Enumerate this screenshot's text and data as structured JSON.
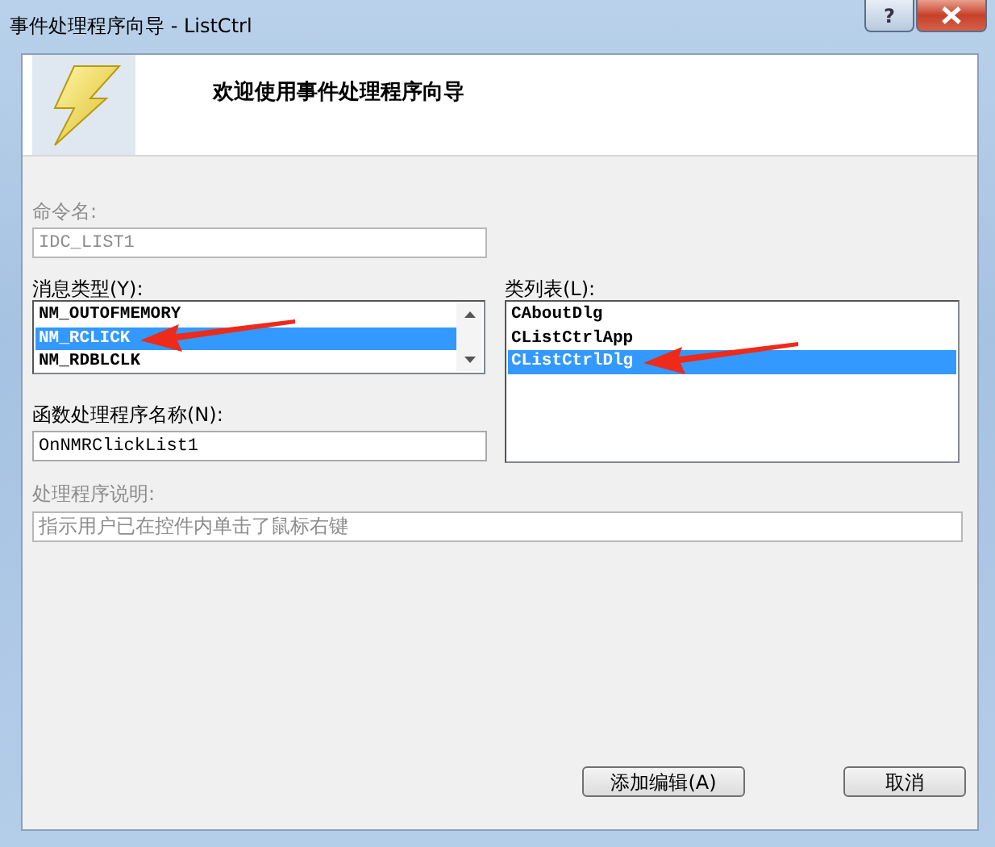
{
  "window": {
    "title": "事件处理程序向导 - ListCtrl",
    "help": "?"
  },
  "header": {
    "title": "欢迎使用事件处理程序向导"
  },
  "command_name": {
    "label": "命令名:",
    "value": "IDC_LIST1",
    "disabled": true
  },
  "message_types": {
    "label": "消息类型(Y):",
    "items": [
      {
        "text": "NM_OUTOFMEMORY",
        "selected": false,
        "arrow": false
      },
      {
        "text": "NM_RCLICK",
        "selected": true,
        "arrow": true
      },
      {
        "text": "NM_RDBLCLK",
        "selected": false,
        "arrow": false
      }
    ]
  },
  "class_list": {
    "label": "类列表(L):",
    "items": [
      {
        "text": "CAboutDlg",
        "selected": false,
        "arrow": false
      },
      {
        "text": "CListCtrlApp",
        "selected": false,
        "arrow": false
      },
      {
        "text": "CListCtrlDlg",
        "selected": true,
        "arrow": true
      }
    ]
  },
  "handler_name": {
    "label": "函数处理程序名称(N):",
    "value": "OnNMRClickList1",
    "disabled": false
  },
  "description": {
    "label": "处理程序说明:",
    "value": "指示用户已在控件内单击了鼠标右键",
    "disabled": true
  },
  "buttons": [
    {
      "label": "添加编辑(A)"
    },
    {
      "label": "取消"
    }
  ]
}
